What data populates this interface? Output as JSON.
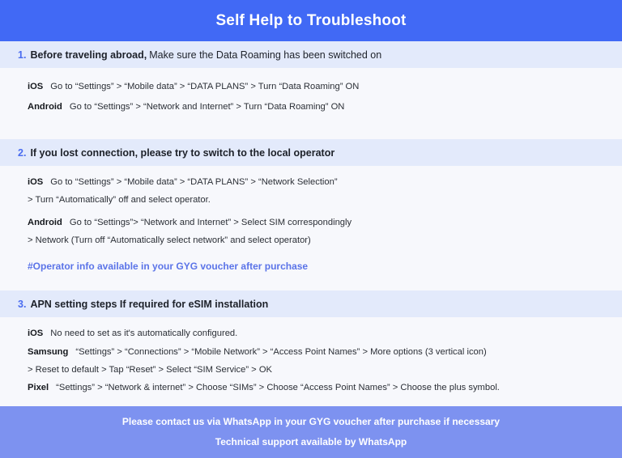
{
  "header": {
    "title": "Self Help to Troubleshoot",
    "bg_color": "#4169F5",
    "text_color": "#FFFFFF"
  },
  "theme": {
    "page_bg": "#F7F8FC",
    "band_bg": "#E3EAFB",
    "accent_blue": "#4A6CF0",
    "note_blue": "#5B74E8",
    "footer_bg": "#7D92F0",
    "body_text": "#2B2F36"
  },
  "sections": [
    {
      "number": "1.",
      "heading_strong": "Before traveling abroad,",
      "heading_rest": "Make sure the Data Roaming has been switched on",
      "rows": [
        {
          "platform": "iOS",
          "steps": "Go to “Settings” > “Mobile data” > “DATA PLANS” > Turn “Data Roaming” ON"
        },
        {
          "platform": "Android",
          "steps": "Go to “Settings” > “Network and Internet” > Turn “Data Roaming” ON"
        }
      ]
    },
    {
      "number": "2.",
      "heading_strong": "If you lost connection, please try to switch to the local operator",
      "heading_rest": "",
      "rows": [
        {
          "platform": "iOS",
          "steps": "Go to “Settings” > “Mobile data” > “DATA PLANS” > “Network Selection”"
        }
      ],
      "continuation_1": "> Turn “Automatically” off and select operator.",
      "android_row": {
        "platform": "Android",
        "steps": "Go to “Settings”>  “Network and Internet” > Select SIM correspondingly"
      },
      "continuation_2": "> Network (Turn off “Automatically select network” and select operator)",
      "note": "#Operator info available in your GYG voucher after purchase"
    },
    {
      "number": "3.",
      "heading_strong": "APN setting steps If required for eSIM installation",
      "heading_rest": "",
      "rows": [
        {
          "platform": "iOS",
          "steps": "No need to set as it's automatically configured."
        },
        {
          "platform": "Samsung",
          "steps": "“Settings” > “Connections” > “Mobile Network” > “Access Point Names” > More options (3 vertical icon)"
        }
      ],
      "continuation_1": "> Reset to default > Tap “Reset” > Select “SIM Service” > OK",
      "pixel_row": {
        "platform": "Pixel",
        "steps": "“Settings” > “Network & internet” > Choose “SIMs” > Choose “Access Point Names” > Choose the plus symbol."
      }
    }
  ],
  "footer": {
    "line1": "Please contact us via WhatsApp  in your GYG voucher after purchase if necessary",
    "line2": "Technical support available by WhatsApp"
  }
}
